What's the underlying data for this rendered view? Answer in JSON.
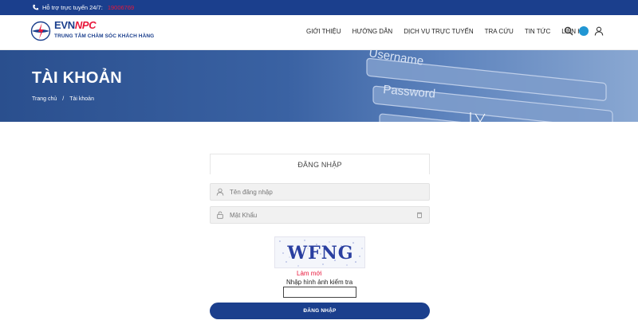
{
  "topbar": {
    "label": "Hỗ trợ trực tuyến 24/7:",
    "hotline": "19006769",
    "icon": "phone-icon"
  },
  "header": {
    "logo_brand_evn": "EVN",
    "logo_brand_npc": "NPC",
    "logo_subtitle": "TRUNG TÂM CHĂM SÓC KHÁCH HÀNG",
    "nav": [
      {
        "label": "GIỚI THIỆU"
      },
      {
        "label": "HƯỚNG DẪN"
      },
      {
        "label": "DỊCH VỤ TRỰC TUYẾN"
      },
      {
        "label": "TRA CỨU"
      },
      {
        "label": "TIN TỨC"
      },
      {
        "label": "LIÊN HỆ"
      }
    ],
    "icons": [
      "search-icon",
      "language-icon",
      "user-icon"
    ]
  },
  "hero": {
    "title": "TÀI KHOẢN",
    "breadcrumb": [
      "Trang chủ",
      "Tài khoản"
    ],
    "art_words": [
      "Username",
      "Password"
    ]
  },
  "login": {
    "heading": "ĐĂNG NHẬP",
    "username_placeholder": "Tên đăng nhập",
    "password_placeholder": "Mật Khẩu",
    "captcha_text": "WFNG",
    "refresh_label": "Làm mới",
    "captcha_label": "Nhập hình ảnh kiểm tra",
    "submit_label": "ĐĂNG NHẬP"
  },
  "colors": {
    "brand_blue": "#1b3f8d",
    "brand_red": "#e8173b"
  }
}
